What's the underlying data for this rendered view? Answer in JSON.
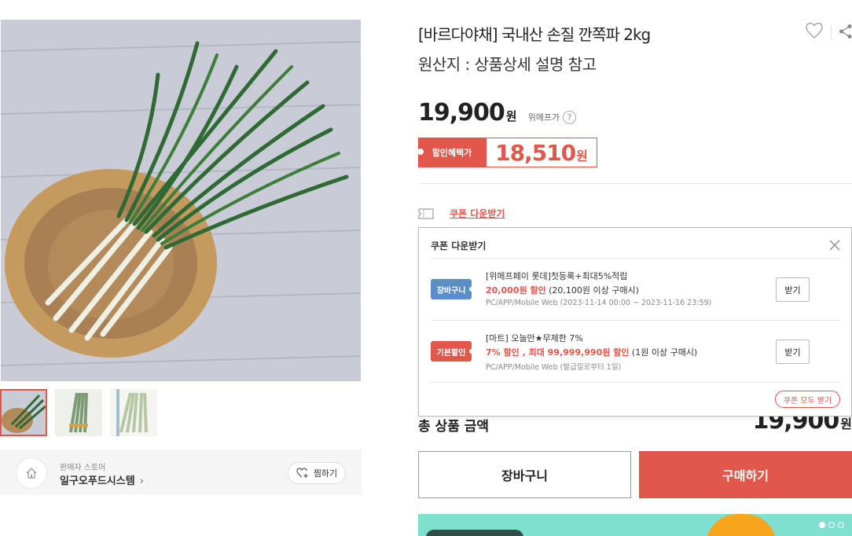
{
  "product": {
    "title": "[바르다야채] 국내산 손질 깐쪽파 2kg",
    "origin": "원산지 : 상품상세 설명 참고",
    "price": "19,900",
    "price_unit": "원",
    "price_ref_label": "위메프가",
    "discount_label": "할인혜택가",
    "discount_price": "18,510",
    "discount_unit": "원"
  },
  "gallery": {
    "main_image": "green onion bundle in woven basket",
    "thumbnail_count": 3,
    "active_thumbnail": 1
  },
  "seller": {
    "caption": "판매자 스토어",
    "name": "일구오푸드시스템",
    "fav_label": "찜하기"
  },
  "coupon_link": {
    "label": "쿠폰 다운받기"
  },
  "coupon_popup": {
    "title": "쿠폰 다운받기",
    "coupons": [
      {
        "badge": "장바구니",
        "badge_color": "#5b8ec9",
        "name": "[위메프페이 롯데]첫등록+최대5%적립",
        "amount_red": "20,000원 할인",
        "amount_rest": " (20,100원 이상 구매시)",
        "period": "PC/APP/Mobile Web (2023-11-14 00:00 ~ 2023-11-16 23:59)",
        "button": "받기"
      },
      {
        "badge": "기본할인",
        "badge_color": "#e2574c",
        "name": "[마트] 오늘만★무제한 7%",
        "amount_red": "7% 할인 , 최대 99,999,990원 할인",
        "amount_rest": " (1원 이상 구매시)",
        "period": "PC/APP/Mobile Web (발급일로부터 1일)",
        "button": "받기"
      }
    ],
    "all_button": "쿠폰 모두 받기"
  },
  "total": {
    "label": "총 상품 금액",
    "value": "19,900",
    "unit": "원"
  },
  "actions": {
    "cart": "장바구니",
    "buy": "구매하기"
  },
  "colors": {
    "accent": "#e2574c",
    "badge_blue": "#5b8ec9",
    "banner": "#7fe0cf"
  }
}
